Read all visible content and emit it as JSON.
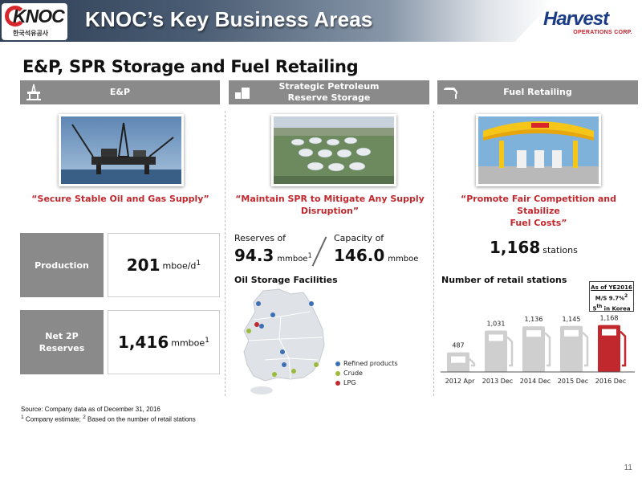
{
  "header": {
    "title": "KNOC’s Key Business Areas",
    "knoc_logo_text": "KNOC",
    "knoc_logo_sub": "한국석유공사",
    "harvest_logo_text": "Harvest",
    "harvest_logo_sub": "OPERATIONS CORP."
  },
  "section_title": "E&P, SPR Storage and Fuel Retailing",
  "columns": {
    "ep": {
      "banner": "E&P",
      "quote": "“Secure Stable Oil and Gas Supply”",
      "production_label": "Production",
      "production_value": "201",
      "production_unit": "mboe/d",
      "production_sup": "1",
      "reserves_label_1": "Net 2P",
      "reserves_label_2": "Reserves",
      "reserves_value": "1,416",
      "reserves_unit": "mmboe",
      "reserves_sup": "1"
    },
    "spr": {
      "banner_line1": "Strategic Petroleum",
      "banner_line2": "Reserve Storage",
      "quote_line1": "“Maintain SPR to Mitigate Any Supply",
      "quote_line2": "Disruption”",
      "reserves_label": "Reserves of",
      "reserves_value": "94.3",
      "reserves_unit": "mmboe",
      "reserves_sup": "1",
      "capacity_label": "Capacity of",
      "capacity_value": "146.0",
      "capacity_unit": "mmboe",
      "facilities_title": "Oil Storage Facilities",
      "legend": [
        {
          "label": "Refined products",
          "color": "#3b6fb6"
        },
        {
          "label": "Crude",
          "color": "#9bbb3a"
        },
        {
          "label": "LPG",
          "color": "#c0282d"
        }
      ]
    },
    "fuel": {
      "banner": "Fuel Retailing",
      "quote_line1": "“Promote Fair Competition and Stabilize",
      "quote_line2": "Fuel Costs”",
      "stations_value": "1,168",
      "stations_unit": "stations",
      "chart_title": "Number of retail stations",
      "ms_line1": "As of YE2016",
      "ms_line2": "M/S 9.7%",
      "ms_sup": "2",
      "ms_line3a": "5",
      "ms_line3_sup": "th",
      "ms_line3b": " in Korea"
    }
  },
  "chart_data": {
    "type": "bar",
    "title": "Number of retail stations",
    "categories": [
      "2012 Apr",
      "2013 Dec",
      "2014 Dec",
      "2015 Dec",
      "2016 Dec"
    ],
    "values": [
      487,
      1031,
      1136,
      1145,
      1168
    ],
    "value_labels": [
      "487",
      "1,031",
      "1,136",
      "1,145",
      "1,168"
    ],
    "colors": {
      "default": "#cfcfcf",
      "highlight": "#c0282d"
    },
    "ylim": [
      0,
      1200
    ]
  },
  "footnotes": {
    "source": "Source: Company data as of December 31, 2016",
    "note_1": "1",
    "note_1_text": " Company estimate; ",
    "note_2": "2",
    "note_2_text": " Based on the number of retail stations"
  },
  "page_number": "11"
}
